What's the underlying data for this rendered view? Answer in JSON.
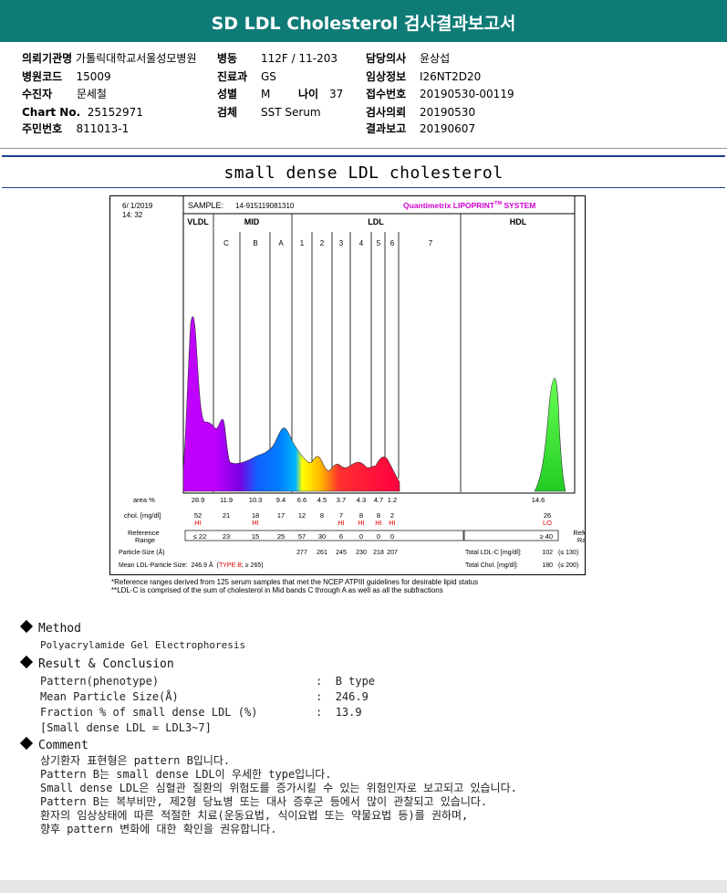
{
  "header": {
    "title": "SD LDL Cholesterol 검사결과보고서"
  },
  "info": {
    "c1": [
      {
        "label": "의뢰기관명",
        "value": "가톨릭대학교서울성모병원"
      },
      {
        "label": "병원코드",
        "value": "15009"
      },
      {
        "label": "수진자",
        "value": "문세철"
      },
      {
        "label": "Chart No.",
        "value": "25152971"
      },
      {
        "label": "주민번호",
        "value": "811013-1"
      }
    ],
    "c2": [
      {
        "label": "병동",
        "value": "112F / 11-203"
      },
      {
        "label": "진료과",
        "value": "GS"
      },
      {
        "label": "성별",
        "value": "M"
      },
      {
        "label": "검체",
        "value": "SST Serum"
      }
    ],
    "age": {
      "label": "나이",
      "value": "37"
    },
    "c3": [
      {
        "label": "담당의사",
        "value": "윤상섭"
      },
      {
        "label": "임상정보",
        "value": "I26NT2D20"
      },
      {
        "label": "접수번호",
        "value": "20190530-00119"
      },
      {
        "label": "검사의뢰",
        "value": "20190530"
      },
      {
        "label": "결과보고",
        "value": "20190607"
      }
    ]
  },
  "section_title": "small dense LDL cholesterol",
  "report": {
    "date": "6/ 1/2019",
    "time": "14: 32",
    "sample_label": "SAMPLE:",
    "sample_id": "14-915119081310",
    "system": "Quantimetrix LIPOPRINT",
    "system_tm": "TM",
    "system_suffix": " SYSTEM",
    "groups": {
      "vldl": "VLDL",
      "mid": "MID",
      "ldl": "LDL",
      "hdl": "HDL"
    },
    "bands": [
      "C",
      "B",
      "A",
      "1",
      "2",
      "3",
      "4",
      "5",
      "6",
      "7"
    ],
    "row_area_label": "area %",
    "row_chol_label": "chol. [mg/dl]",
    "ref_label": "Reference\nRange",
    "area": [
      "28.9",
      "11.9",
      "10.3",
      "9.4",
      "6.6",
      "4.5",
      "3.7",
      "4.3",
      "4.7",
      "1.2"
    ],
    "chol": [
      "52",
      "21",
      "18",
      "17",
      "12",
      "8",
      "7",
      "8",
      "8",
      "2"
    ],
    "chol_flags": [
      "HI",
      "",
      "HI",
      "",
      "",
      "",
      "HI",
      "HI",
      "HI",
      "HI"
    ],
    "ref": [
      "≤ 22",
      "23",
      "15",
      "25",
      "57",
      "30",
      "6",
      "0",
      "0",
      "0"
    ],
    "hdl_area": "14.6",
    "hdl_chol": "26",
    "hdl_flag": "LO",
    "hdl_ref": "≥ 40",
    "particle_label": "Particle-Size (Å)",
    "particle": [
      "277",
      "261",
      "245",
      "230",
      "218",
      "207"
    ],
    "mean_label": "Mean LDL-Particle Size:",
    "mean_value": "246.9 Å",
    "mean_type": "TYPE B",
    "mean_ref": "≥ 265",
    "total_ldl_label": "Total LDL-C [mg/dl]:",
    "total_ldl": "102",
    "total_ldl_ref": "≤ 130",
    "total_chol_label": "Total Chol. [mg/dl]:",
    "total_chol": "180",
    "total_chol_ref": "≤ 200",
    "note1": "*Reference ranges derived from 125 serum samples that met the NCEP ATPIII guidelines for desirable lipid status",
    "note2": "**LDL-C is comprised of the sum of cholesterol in Mid bands C through A as well as all the subfractions"
  },
  "method": {
    "heading": "Method",
    "text": "Polyacrylamide Gel Electrophoresis"
  },
  "result": {
    "heading": "Result & Conclusion",
    "rows": [
      {
        "k": "Pattern(phenotype)",
        "v": "B type"
      },
      {
        "k": "Mean Particle Size(Å)",
        "v": "246.9"
      },
      {
        "k": "Fraction % of small dense LDL (%)",
        "v": "13.9"
      }
    ],
    "note": "[Small dense LDL = LDL3~7]"
  },
  "comment": {
    "heading": "Comment",
    "lines": [
      "상기환자 표현형은 pattern B입니다.",
      "Pattern B는 small dense LDL이 우세한 type입니다.",
      "Small dense LDL은 심혈관 질환의 위험도를 증가시킬 수 있는 위험인자로 보고되고 있습니다.",
      "Pattern B는 복부비만, 제2형 당뇨병 또는 대사 증후군 등에서 많이 관찰되고 있습니다.",
      "환자의 임상상태에 따른 적절한 치료(운동요법, 식이요법 또는 약물요법 등)를 권하며,",
      "향후 pattern 변화에 대한 확인을 권유합니다."
    ]
  },
  "colors": {
    "header": "#0f7b77",
    "rule": "#1d3f8c",
    "flag": "#e00000",
    "system": "#d000d0"
  }
}
